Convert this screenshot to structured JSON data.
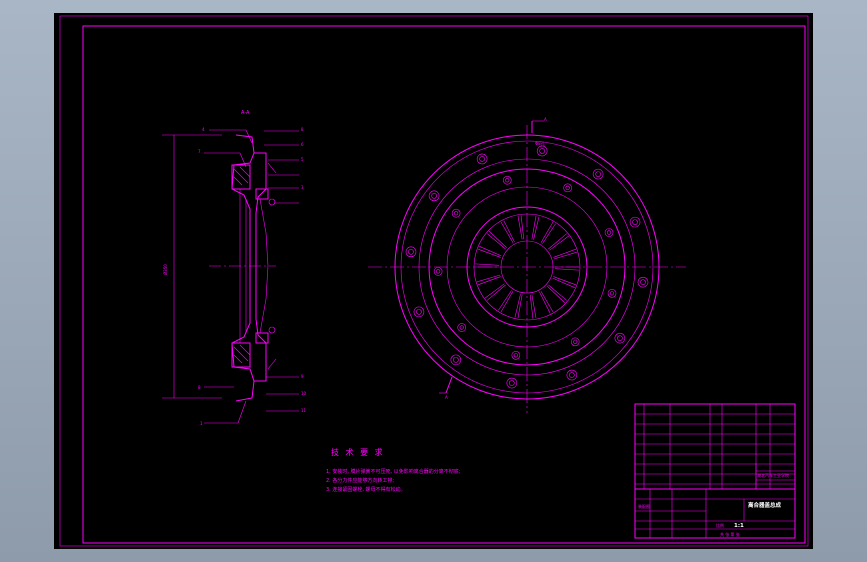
{
  "drawing": {
    "section_label": "A-A",
    "view_marker": "A",
    "dimension_main": "Ø350",
    "parts_left_top": [
      "4",
      "7",
      "8",
      "6",
      "5",
      "3"
    ],
    "parts_left_bottom": [
      "8",
      "1",
      "9",
      "10",
      "11"
    ],
    "dimension_callout": "Φ8孔",
    "tech_requirements": {
      "title": "技 术 要 求",
      "items": [
        "1. 安装时, 膜片弹簧不可压死, 以免影响离合器的分离不彻底;",
        "2. 各分力件应能够方向转工排;",
        "3. 连接紧固螺栓, 螺母不得有松动。"
      ]
    },
    "title_block": {
      "drawing_name": "离合器盖总成",
      "scale": "1:1",
      "school": "湖北汽车工业学院",
      "scale_label": "比例",
      "sheet_label": "共 张 第 张",
      "material": "装配图"
    }
  }
}
